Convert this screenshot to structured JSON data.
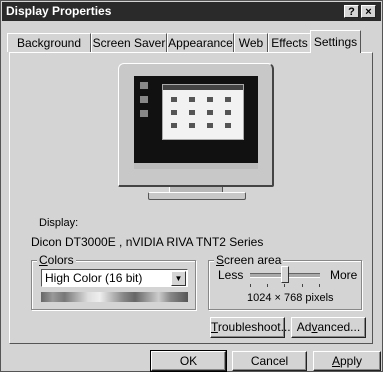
{
  "window": {
    "title": "Display Properties",
    "help_label": "?",
    "close_label": "×"
  },
  "tabs": [
    {
      "label": "Background"
    },
    {
      "label": "Screen Saver"
    },
    {
      "label": "Appearance"
    },
    {
      "label": "Web"
    },
    {
      "label": "Effects"
    },
    {
      "label": "Settings",
      "active": true
    }
  ],
  "display": {
    "label": "Display:",
    "value": "Dicon  DT3000E , nVIDIA RIVA TNT2 Series"
  },
  "colors": {
    "legend_mnemonic": "C",
    "legend_rest": "olors",
    "selected": "High Color (16 bit)"
  },
  "screen_area": {
    "legend_mnemonic": "S",
    "legend_rest": "creen area",
    "less_label": "Less",
    "more_label": "More",
    "resolution": "1024 × 768 pixels",
    "level": 0.5
  },
  "buttons": {
    "troubleshoot_mnemonic": "T",
    "troubleshoot_rest": "roubleshoot...",
    "advanced_pre": "Ad",
    "advanced_mnemonic": "v",
    "advanced_post": "anced...",
    "ok": "OK",
    "cancel": "Cancel",
    "apply_mnemonic": "A",
    "apply_rest": "pply"
  }
}
